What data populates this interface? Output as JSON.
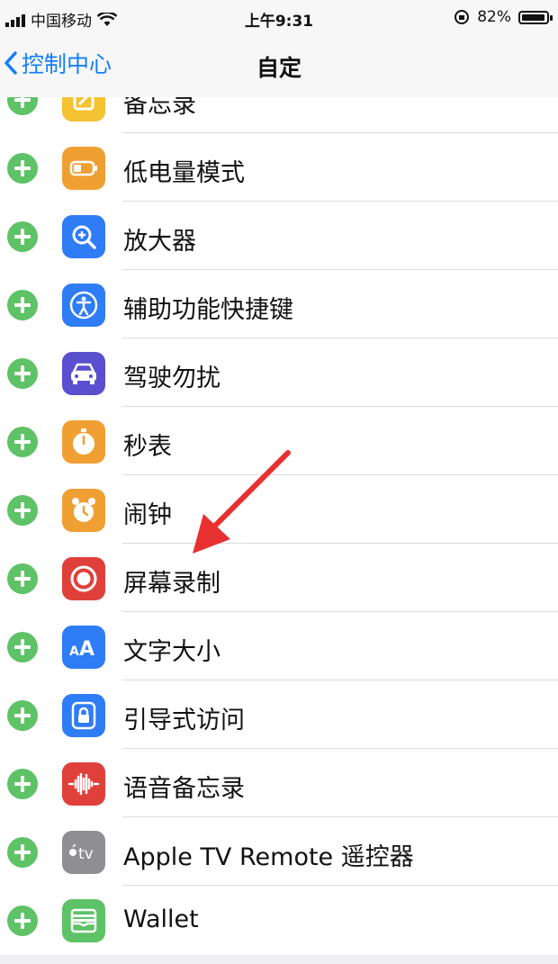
{
  "status_bar": {
    "carrier": "中国移动",
    "time": "上午9:31",
    "battery": "82%"
  },
  "nav": {
    "back_label": "控制中心",
    "title": "自定"
  },
  "items": [
    {
      "label": "备忘录",
      "color": "#f5c232",
      "icon": "notes-icon"
    },
    {
      "label": "低电量模式",
      "color": "#f0a033",
      "icon": "low-power-icon"
    },
    {
      "label": "放大器",
      "color": "#2e7cf6",
      "icon": "magnifier-icon"
    },
    {
      "label": "辅助功能快捷键",
      "color": "#2e7cf6",
      "icon": "accessibility-icon"
    },
    {
      "label": "驾驶勿扰",
      "color": "#5a4fcf",
      "icon": "car-icon"
    },
    {
      "label": "秒表",
      "color": "#f0a033",
      "icon": "stopwatch-icon"
    },
    {
      "label": "闹钟",
      "color": "#f0a033",
      "icon": "alarm-icon"
    },
    {
      "label": "屏幕录制",
      "color": "#e0403a",
      "icon": "screen-record-icon"
    },
    {
      "label": "文字大小",
      "color": "#2e7cf6",
      "icon": "text-size-icon"
    },
    {
      "label": "引导式访问",
      "color": "#2e7cf6",
      "icon": "guided-access-icon"
    },
    {
      "label": "语音备忘录",
      "color": "#e0403a",
      "icon": "voice-memo-icon"
    },
    {
      "label": "Apple TV Remote 遥控器",
      "color": "#8e8e93",
      "icon": "apple-tv-icon"
    },
    {
      "label": "Wallet",
      "color": "#5ec266",
      "icon": "wallet-icon"
    }
  ]
}
